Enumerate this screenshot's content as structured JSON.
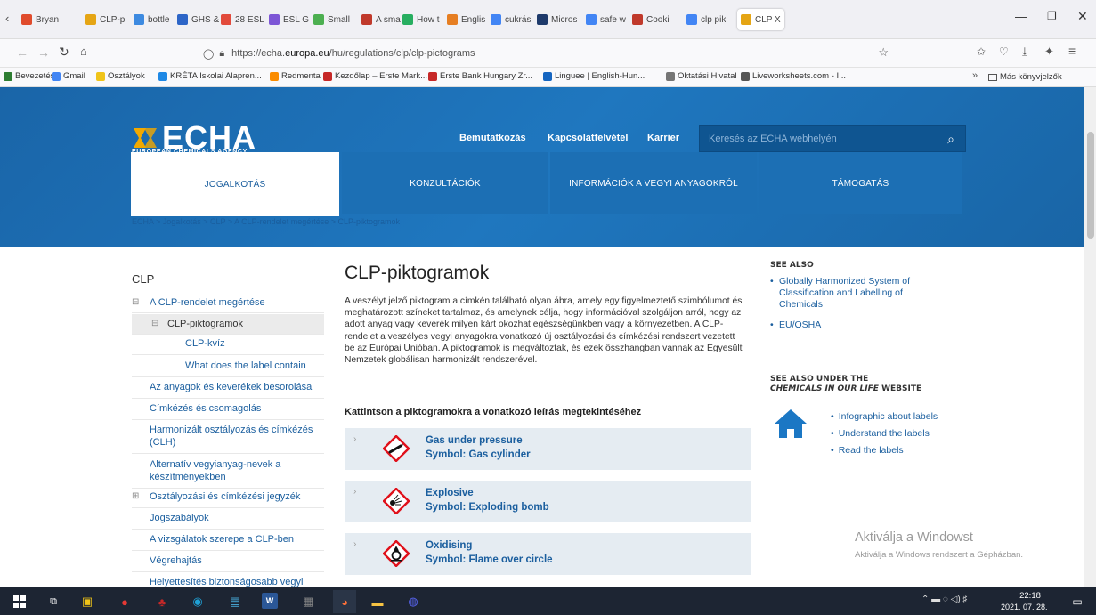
{
  "browser": {
    "tabs": [
      {
        "label": "Bryan",
        "color": "#e04b2c"
      },
      {
        "label": "CLP-p",
        "color": "#e5a514"
      },
      {
        "label": "bottle",
        "color": "#3d8ae0"
      },
      {
        "label": "GHS &",
        "color": "#2d65c7"
      },
      {
        "label": "28 ESL",
        "color": "#e24a3b"
      },
      {
        "label": "ESL G",
        "color": "#7d56d6"
      },
      {
        "label": "Small",
        "color": "#4caf50"
      },
      {
        "label": "A sma",
        "color": "#c0392b"
      },
      {
        "label": "How t",
        "color": "#27ae60"
      },
      {
        "label": "Englis",
        "color": "#e67e22"
      },
      {
        "label": "cukrás",
        "color": "#4285f4"
      },
      {
        "label": "Micros",
        "color": "#1e3a6b"
      },
      {
        "label": "safe w",
        "color": "#4285f4"
      },
      {
        "label": "Cooki",
        "color": "#c0392b"
      },
      {
        "label": "clp pik",
        "color": "#4285f4"
      },
      {
        "label": "CLP X",
        "color": "#e5a514"
      }
    ],
    "url_prefix": "https://echa.",
    "url_domain": "europa.eu",
    "url_rest": "/hu/regulations/clp/clp-pictograms",
    "bookmarks": [
      "Bevezetés",
      "Gmail",
      "Osztályok",
      "KRÉTA Iskolai Alapren...",
      "Redmenta",
      "Kezdőlap – Erste Mark...",
      "Erste Bank Hungary Zr...",
      "Linguee | English-Hun...",
      "Oktatási Hivatal",
      "Liveworksheets.com - I..."
    ],
    "other_bookmarks": "Más könyvjelzők"
  },
  "header": {
    "logo_main": "ECHA",
    "logo_sub": "EUROPEAN CHEMICALS AGENCY",
    "links": [
      "Bemutatkozás",
      "Kapcsolatfelvétel",
      "Karrier"
    ],
    "search_placeholder": "Keresés az ECHA webhelyén",
    "tabs": [
      "JOGALKOTÁS",
      "KONZULTÁCIÓK",
      "INFORMÁCIÓK A VEGYI ANYAGOKRÓL",
      "TÁMOGATÁS"
    ],
    "breadcrumb": "ECHA  >  Jogalkotás  >  CLP  >  A CLP-rendelet megértése  >  CLP-piktogramok"
  },
  "leftnav": {
    "title": "CLP",
    "items": [
      "A CLP-rendelet megértése",
      "CLP-piktogramok",
      "CLP-kvíz",
      "What does the label contain",
      "Az anyagok és keverékek besorolása",
      "Címkézés és csomagolás",
      "Harmonizált osztályozás és címkézés (CLH)",
      "Alternatív vegyianyag-nevek a készítményekben",
      "Osztályozási és címkézési jegyzék",
      "Jogszabályok",
      "A vizsgálatok szerepe a CLP-ben",
      "Végrehajtás",
      "Helyettesítés biztonságosabb vegyi"
    ]
  },
  "main": {
    "title": "CLP-piktogramok",
    "intro": "A veszélyt jelző piktogram a címkén található olyan ábra, amely egy figyelmeztető szimbólumot és meghatározott színeket tartalmaz, és amelynek célja, hogy információval szolgáljon arról, hogy az adott anyag vagy keverék milyen kárt okozhat egészségünkben vagy a környezetben. A CLP-rendelet a veszélyes vegyi anyagokra vonatkozó új osztályozási és címkézési rendszert vezetett be az Európai Unióban. A piktogramok is megváltoztak, és ezek összhangban vannak az Egyesült Nemzetek globálisan harmonizált rendszerével.",
    "instruction": "Kattintson a piktogramokra a vonatkozó leírás megtekintéséhez",
    "pictograms": [
      {
        "name": "Gas under pressure",
        "symbol": "Symbol: Gas cylinder"
      },
      {
        "name": "Explosive",
        "symbol": "Symbol: Exploding bomb"
      },
      {
        "name": "Oxidising",
        "symbol": "Symbol: Flame over circle"
      }
    ]
  },
  "sidebar": {
    "see_also_title": "SEE ALSO",
    "see_also": [
      "Globally Harmonized System of Classification and Labelling of Chemicals",
      "EU/OSHA"
    ],
    "under_title_1": "SEE ALSO UNDER THE",
    "under_title_2": "CHEMICALS IN OUR LIFE",
    "under_title_3": " WEBSITE",
    "links": [
      "Infographic about labels",
      "Understand the labels",
      "Read the labels"
    ]
  },
  "watermark": {
    "title": "Aktiválja a Windowst",
    "sub": "Aktiválja a Windows rendszert a Gépházban."
  },
  "taskbar": {
    "time": "22:18",
    "date": "2021. 07. 28."
  },
  "colors": {
    "brand": "#1b6bb0",
    "link": "#1a5e9e",
    "hazard": "#e0101a"
  }
}
